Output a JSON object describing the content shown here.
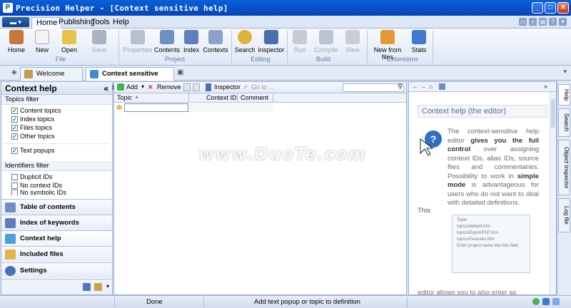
{
  "window": {
    "title": "Precision Helper - [Context sensitive help]"
  },
  "ribbon_tabs": [
    "Home",
    "Publishing",
    "Tools",
    "Help"
  ],
  "ribbon": {
    "buttons": {
      "home": "Home",
      "new": "New",
      "open": "Open",
      "save": "Save",
      "properties": "Properties",
      "contents": "Contents",
      "index": "Index",
      "contexts": "Contexts",
      "search": "Search",
      "inspector": "Inspector",
      "run": "Run",
      "compile": "Compile",
      "view": "View",
      "new_from_files": "New from files",
      "stats": "Stats"
    },
    "groups": {
      "file": "File",
      "project": "Project",
      "editing": "Editing",
      "build": "Build",
      "extensions": "Extensions"
    }
  },
  "doc_tabs": {
    "welcome": "Welcome page",
    "context": "Context sensitive help"
  },
  "left_panel": {
    "title": "Context help",
    "collapse": "«",
    "topics_filter": "Topics filter",
    "topics": [
      "Content topics",
      "Index topics",
      "Files topics",
      "Other topics"
    ],
    "text_popups": "Text popups",
    "identifiers_filter": "Identifiers filter",
    "identifiers": [
      "Duplicit IDs",
      "No context IDs",
      "No symbolic IDs"
    ],
    "nav": [
      "Table of contents",
      "Index of keywords",
      "Context help",
      "Included files",
      "Settings"
    ]
  },
  "center": {
    "toolbar": {
      "add": "Add",
      "remove": "Remove",
      "inspector": "Inspector",
      "goto": "Go to ..."
    },
    "columns": [
      "Topic",
      "Context ID",
      "Comment"
    ]
  },
  "right_panel": {
    "heading": "Context help (the editor)",
    "para_plain1": "The context-sensitive help editor ",
    "para_bold1": "gives you the full control",
    "para_plain2": " over assigning context IDs, alias IDs, source files and commentaries. Possibility to work in ",
    "para_bold2": "simple mode",
    "para_plain3": " is advantageous for users who do not want to deal with detailed definitions.",
    "this_text": "This",
    "thumb_lines": [
      "Topic",
      "topics\\default.htm",
      "topics\\ExportPDF.htm",
      "topics\\Features.htm",
      "Enter project name into this field."
    ],
    "bottom_text": "editor allows you to also enter as"
  },
  "side_tabs": [
    "Help",
    "Search",
    "Object Inspector",
    "Log file"
  ],
  "status": {
    "left": "Done",
    "middle": "Add text popup or topic to definition"
  },
  "watermark": "www.DuoTe.com"
}
